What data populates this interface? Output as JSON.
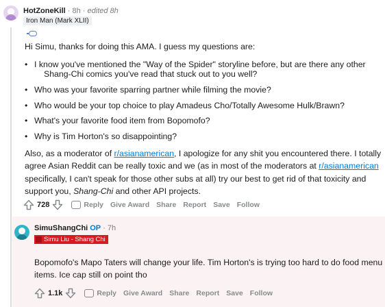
{
  "comment": {
    "username": "HotZoneKill",
    "time": "8h",
    "edited": "edited 8h",
    "flair": "Iron Man (Mark XLII)",
    "intro": "Hi Simu, thanks for doing this AMA. I guess my questions are:",
    "questions": [
      "I know you've mentioned the \"Way of the Spider\" storyline before, but are there any other",
      "Shang-Chi comics you've read that stuck out to you well?",
      "Who was your favorite sparring partner while filming the movie?",
      "Who would be your top choice to play Amadeus Cho/Totally Awesome Hulk/Brawn?",
      "What's your favorite food item from Bopomofo?",
      "Why is Tim Horton's so disappointing?"
    ],
    "closing": {
      "part1": "Also, as a moderator of ",
      "link1": "r/asianamerican",
      "part2": ", I apologize for any shit you encountered there. I totally agree Asian Reddit can be really toxic and we (as in most of the moderators at ",
      "link2": "r/asianamerican",
      "part3": " specifically, I can't speak for those other subs at all) try our best to get rid of that toxicity and support you, ",
      "italic": "Shang-Chi",
      "part4": " and other API projects."
    },
    "actions": {
      "score": "728",
      "reply": "Reply",
      "give_award": "Give Award",
      "share": "Share",
      "report": "Report",
      "save": "Save",
      "follow": "Follow"
    }
  },
  "reply": {
    "username": "SimuShangChi",
    "op": "OP",
    "time": "7h",
    "flair": "Simu Liu - Shang Chi",
    "text_line1": "Bopomofo's Mapo Taters will change your life. Tim Horton's is trying too hard to do food menu",
    "text_line2": "items. Ice cap still on point tho",
    "actions": {
      "score": "1.1k",
      "reply": "Reply",
      "give_award": "Give Award",
      "share": "Share",
      "report": "Report",
      "save": "Save",
      "follow": "Follow"
    }
  },
  "colors": {
    "link": "#0079d3",
    "op": "#0079d3",
    "flair_red": "#d81b21",
    "reply_bg": "#fbf3f3",
    "meta_gray": "#7c7c7c"
  }
}
